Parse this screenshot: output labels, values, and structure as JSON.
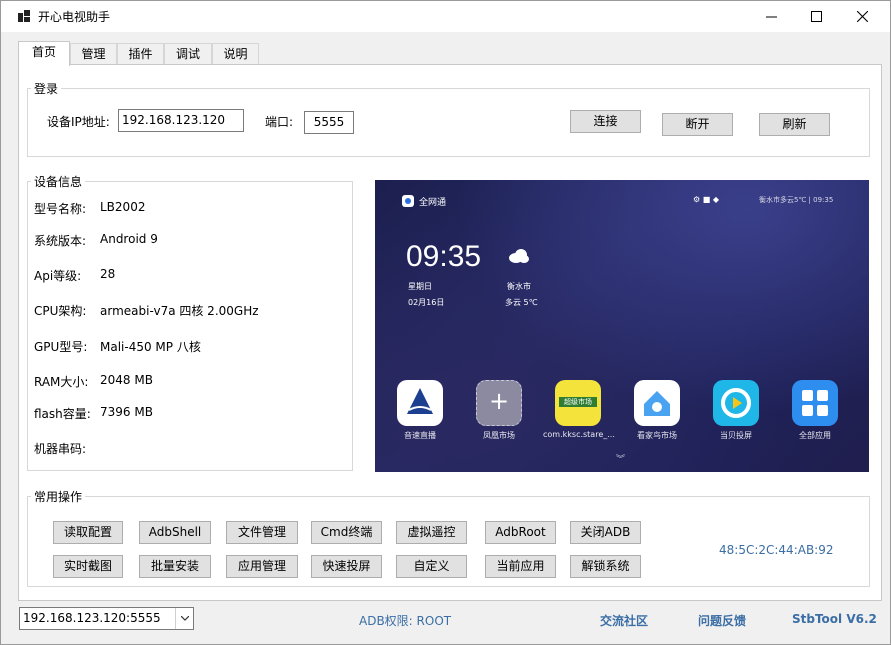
{
  "window": {
    "title": "开心电视助手",
    "min_icon": "minimize-icon",
    "max_icon": "maximize-icon",
    "close_icon": "close-icon"
  },
  "tabs": [
    {
      "label": "首页",
      "active": true
    },
    {
      "label": "管理"
    },
    {
      "label": "插件"
    },
    {
      "label": "调试"
    },
    {
      "label": "说明"
    }
  ],
  "login": {
    "legend": "登录",
    "ip_label": "设备IP地址:",
    "ip_value": "192.168.123.120",
    "port_label": "端口:",
    "port_value": "5555",
    "connect": "连接",
    "disconnect": "断开",
    "refresh": "刷新"
  },
  "device_info": {
    "legend": "设备信息",
    "rows": [
      {
        "label": "型号名称:",
        "value": "LB2002"
      },
      {
        "label": "系统版本:",
        "value": "Android 9"
      },
      {
        "label": "Api等级:",
        "value": "28"
      },
      {
        "label": "CPU架构:",
        "value": "armeabi-v7a 四核 2.00GHz"
      },
      {
        "label": "GPU型号:",
        "value": "Mali-450 MP 八核"
      },
      {
        "label": "RAM大小:",
        "value": "2048 MB"
      },
      {
        "label": "flash容量:",
        "value": "7396 MB"
      },
      {
        "label": "机器串码:",
        "value": ""
      }
    ]
  },
  "tv_screen": {
    "brand": "全网通",
    "status": "衡水市多云5℃ | 09:35",
    "time": "09:35",
    "weekday": "星期日",
    "date": "02月16日",
    "city": "衡水市",
    "weather": "多云 5℃",
    "apps": [
      {
        "name": "音速直播",
        "color": "#ffffff"
      },
      {
        "name": "凤凰市场",
        "color": "#8c8aa0"
      },
      {
        "name": "com.kksc.stare_...",
        "color": "#f3e33a",
        "badge": "超级市场"
      },
      {
        "name": "看家鸟市场",
        "color": "#ffffff"
      },
      {
        "name": "当贝投屏",
        "color": "#1fb7e8"
      },
      {
        "name": "全部应用",
        "color": "#2d8ef0"
      }
    ]
  },
  "ops": {
    "legend": "常用操作",
    "row1": [
      "读取配置",
      "AdbShell",
      "文件管理",
      "Cmd终端",
      "虚拟遥控",
      "AdbRoot",
      "关闭ADB"
    ],
    "row2": [
      "实时截图",
      "批量安装",
      "应用管理",
      "快速投屏",
      "自定义",
      "当前应用",
      "解锁系统"
    ],
    "mac": "48:5C:2C:44:AB:92"
  },
  "statusbar": {
    "device": "192.168.123.120:5555",
    "adb_perm": "ADB权限:  ROOT",
    "community": "交流社区",
    "feedback": "问题反馈",
    "version": "StbTool V6.2"
  },
  "colors": {
    "link": "#3a6ea5",
    "mac": "#3a6ea5"
  }
}
